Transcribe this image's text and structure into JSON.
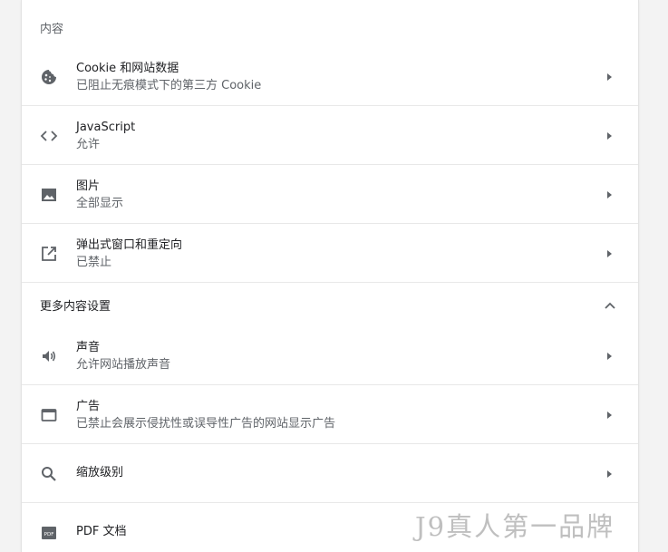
{
  "sections": {
    "content_title": "内容",
    "more_title": "更多内容设置"
  },
  "rows": [
    {
      "title": "Cookie 和网站数据",
      "subtitle": "已阻止无痕模式下的第三方 Cookie",
      "icon": "cookie-icon"
    },
    {
      "title": "JavaScript",
      "subtitle": "允许",
      "icon": "code-icon"
    },
    {
      "title": "图片",
      "subtitle": "全部显示",
      "icon": "image-icon"
    },
    {
      "title": "弹出式窗口和重定向",
      "subtitle": "已禁止",
      "icon": "open-in-new-icon"
    }
  ],
  "more_rows": [
    {
      "title": "声音",
      "subtitle": "允许网站播放声音",
      "icon": "volume-icon"
    },
    {
      "title": "广告",
      "subtitle": "已禁止会展示侵扰性或误导性广告的网站显示广告",
      "icon": "ads-window-icon"
    },
    {
      "title": "缩放级别",
      "subtitle": "",
      "icon": "search-icon"
    },
    {
      "title": "PDF 文档",
      "subtitle": "",
      "icon": "pdf-icon"
    }
  ],
  "watermark": "J9真人第一品牌",
  "colors": {
    "text_primary": "#202124",
    "text_secondary": "#5f6368",
    "icon": "#5f6368",
    "divider": "#e8e8e8",
    "background": "#f3f3f3"
  }
}
